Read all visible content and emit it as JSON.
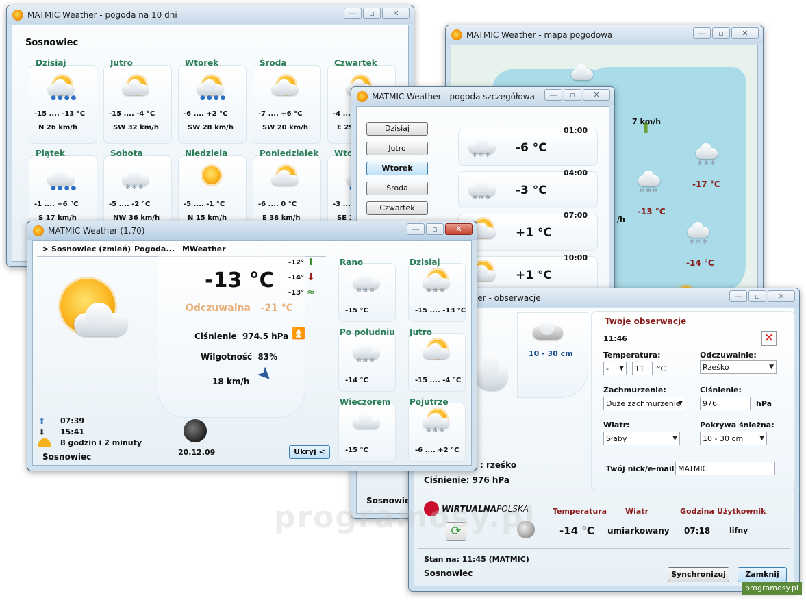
{
  "forecast10": {
    "title": "MATMIC Weather - pogoda na 10 dni",
    "city": "Sosnowiec",
    "days": [
      {
        "name": "Dzisiaj",
        "temp": "-15 .... -13 °C",
        "wind": "N 26 km/h",
        "icon": "sun-cloud-rain-icon"
      },
      {
        "name": "Jutro",
        "temp": "-15 .... -4 °C",
        "wind": "SW 32 km/h",
        "icon": "sun-cloud-icon"
      },
      {
        "name": "Wtorek",
        "temp": "-6 .... +2 °C",
        "wind": "SW 28 km/h",
        "icon": "sun-cloud-rain-icon"
      },
      {
        "name": "Środa",
        "temp": "-7 .... +6 °C",
        "wind": "SW 20 km/h",
        "icon": "sun-cloud-icon"
      },
      {
        "name": "Czwartek",
        "temp": "-4 ....",
        "wind": "E 29",
        "icon": "sun-cloud-icon"
      },
      {
        "name": "Piątek",
        "temp": "-1 .... +6 °C",
        "wind": "S 17 km/h",
        "icon": "cloud-rain-icon"
      },
      {
        "name": "Sobota",
        "temp": "-5 .... -2 °C",
        "wind": "NW 36 km/h",
        "icon": "cloud-snow-icon"
      },
      {
        "name": "Niedziela",
        "temp": "-5 .... -1 °C",
        "wind": "N 15 km/h",
        "icon": "sun-icon"
      },
      {
        "name": "Poniedziałek",
        "temp": "-6 .... 0 °C",
        "wind": "E 38 km/h",
        "icon": "sun-cloud-icon"
      },
      {
        "name": "Wto",
        "temp": "-3 ....",
        "wind": "SE 1",
        "icon": "cloud-rain-icon"
      }
    ]
  },
  "mapwin": {
    "title": "MATMIC Weather - mapa pogodowa",
    "wind": "7 km/h",
    "wind_fragment": "/h",
    "temps": [
      "-17 °C",
      "-13 °C",
      "-14 °C"
    ]
  },
  "detail": {
    "title": "MATMIC Weather - pogoda szczegółowa",
    "buttons": [
      "Dzisiaj",
      "Jutro",
      "Wtorek",
      "Środa",
      "Czwartek"
    ],
    "rows": [
      {
        "time": "01:00",
        "temp": "-6 °C"
      },
      {
        "time": "04:00",
        "temp": "-3 °C"
      },
      {
        "time": "07:00",
        "temp": "+1 °C"
      },
      {
        "time": "10:00",
        "temp": "+1 °C"
      }
    ],
    "city": "Sosnowie"
  },
  "main": {
    "title": "MATMIC Weather (1.70)",
    "menu": [
      "> Sosnowiec (zmień)",
      "Pogoda...",
      "MWeather"
    ],
    "temp": "-13 °C",
    "feels_label": "Odczuwalna",
    "feels": "-21 °C",
    "trend": [
      "-12°",
      "-14°",
      "-13°"
    ],
    "pressure_label": "Ciśnienie",
    "pressure": "974.5 hPa",
    "humidity_label": "Wilgotność",
    "humidity": "83%",
    "wind": "18 km/h",
    "sunrise": "07:39",
    "sunset": "15:41",
    "daylength": "8 godzin i 2 minuty",
    "date": "20.12.09",
    "city": "Sosnowiec",
    "hide_button": "Ukryj <",
    "periods": [
      {
        "name": "Rano",
        "temp": "-15 °C"
      },
      {
        "name": "Dzisiaj",
        "temp": "-15 .... -13 °C"
      },
      {
        "name": "Po południu",
        "temp": "-14 °C"
      },
      {
        "name": "Jutro",
        "temp": "-15 .... -4 °C"
      },
      {
        "name": "Wieczorem",
        "temp": "-15 °C"
      },
      {
        "name": "Pojutrze",
        "temp": "-6 .... +2 °C"
      }
    ]
  },
  "obs": {
    "title": "ther - obserwacje",
    "snow": "10 - 30 cm",
    "section": "Twoje obserwacje",
    "time": "11:46",
    "temp_label": "Temperatura:",
    "temp_sign": "-",
    "temp_value": "11",
    "temp_unit": "°C",
    "feel_label": "Odczuwalnie:",
    "feel_value": "Rześko",
    "cloud_label": "Zachmurzenie:",
    "cloud_value": "Duże zachmurzenie",
    "press_label": "Ciśnienie:",
    "press_value": "976",
    "press_unit": "hPa",
    "wind_label": "Wiatr:",
    "wind_value": "Słaby",
    "snowcover_label": "Pokrywa śnieżna:",
    "snowcover_value": "10 - 30 cm",
    "nick_label": "Twój nick/e-mail:",
    "nick_value": "MATMIC",
    "left_fragment": ": rześko",
    "left_pressure": "Ciśnienie: 976 hPa",
    "brand": "WIRTUALNA",
    "brand2": "POLSKA",
    "headers": [
      "Temperatura",
      "Wiatr",
      "Godzina",
      "Użytkownik"
    ],
    "row": [
      "-14 °C",
      "umiarkowany",
      "07:18",
      "lifny"
    ],
    "status": "Stan na: 11:45 (MATMIC)",
    "city": "Sosnowiec",
    "sync": "Synchronizuj",
    "close": "Zamknij"
  },
  "watermark": "programosy.pl",
  "badge": "programosy.pl",
  "colors": {
    "green": "#2a7d55",
    "maroon": "#8b1a1a",
    "feels": "#e8b07a"
  }
}
